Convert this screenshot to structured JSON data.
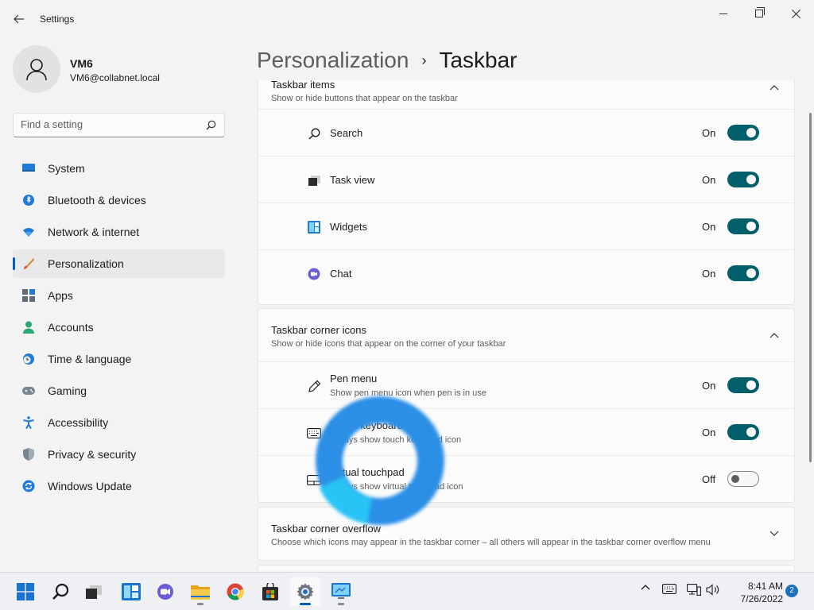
{
  "window": {
    "title": "Settings"
  },
  "user": {
    "name": "VM6",
    "email": "VM6@collabnet.local"
  },
  "search": {
    "placeholder": "Find a setting"
  },
  "sidebar": {
    "items": [
      {
        "label": "System",
        "icon": "system-icon"
      },
      {
        "label": "Bluetooth & devices",
        "icon": "bluetooth-icon"
      },
      {
        "label": "Network & internet",
        "icon": "wifi-icon"
      },
      {
        "label": "Personalization",
        "icon": "brush-icon",
        "active": true
      },
      {
        "label": "Apps",
        "icon": "apps-icon"
      },
      {
        "label": "Accounts",
        "icon": "accounts-icon"
      },
      {
        "label": "Time & language",
        "icon": "time-icon"
      },
      {
        "label": "Gaming",
        "icon": "gamepad-icon"
      },
      {
        "label": "Accessibility",
        "icon": "accessibility-icon"
      },
      {
        "label": "Privacy & security",
        "icon": "shield-icon"
      },
      {
        "label": "Windows Update",
        "icon": "update-icon"
      }
    ]
  },
  "breadcrumb": {
    "parent": "Personalization",
    "separator": "›",
    "current": "Taskbar"
  },
  "sections": {
    "taskbar_items": {
      "title": "Taskbar items",
      "subtitle": "Show or hide buttons that appear on the taskbar",
      "rows": [
        {
          "label": "Search",
          "state": "On",
          "on": true,
          "icon": "search-icon"
        },
        {
          "label": "Task view",
          "state": "On",
          "on": true,
          "icon": "task-view-icon"
        },
        {
          "label": "Widgets",
          "state": "On",
          "on": true,
          "icon": "widgets-icon"
        },
        {
          "label": "Chat",
          "state": "On",
          "on": true,
          "icon": "chat-icon"
        }
      ]
    },
    "corner_icons": {
      "title": "Taskbar corner icons",
      "subtitle": "Show or hide icons that appear on the corner of your taskbar",
      "rows": [
        {
          "label": "Pen menu",
          "desc": "Show pen menu icon when pen is in use",
          "state": "On",
          "on": true,
          "icon": "pen-icon"
        },
        {
          "label": "Touch keyboard",
          "desc": "Always show touch keyboard icon",
          "state": "On",
          "on": true,
          "icon": "keyboard-icon"
        },
        {
          "label": "Virtual touchpad",
          "desc": "Always show virtual touchpad icon",
          "state": "Off",
          "on": false,
          "icon": "touchpad-icon"
        }
      ]
    },
    "corner_overflow": {
      "title": "Taskbar corner overflow",
      "subtitle": "Choose which icons may appear in the taskbar corner – all others will appear in the taskbar corner overflow menu"
    }
  },
  "taskbar": {
    "apps": [
      "start-icon",
      "search-icon",
      "task-view-icon",
      "widgets-icon",
      "chat-icon",
      "file-explorer-icon",
      "chrome-icon",
      "store-icon",
      "settings-icon",
      "remote-desktop-icon"
    ],
    "time": "8:41 AM",
    "date": "7/26/2022",
    "notification_count": "2"
  },
  "colors": {
    "accent": "#005fb8",
    "toggle_on": "#005f6b",
    "busy_ring": "#2b8fe6"
  }
}
